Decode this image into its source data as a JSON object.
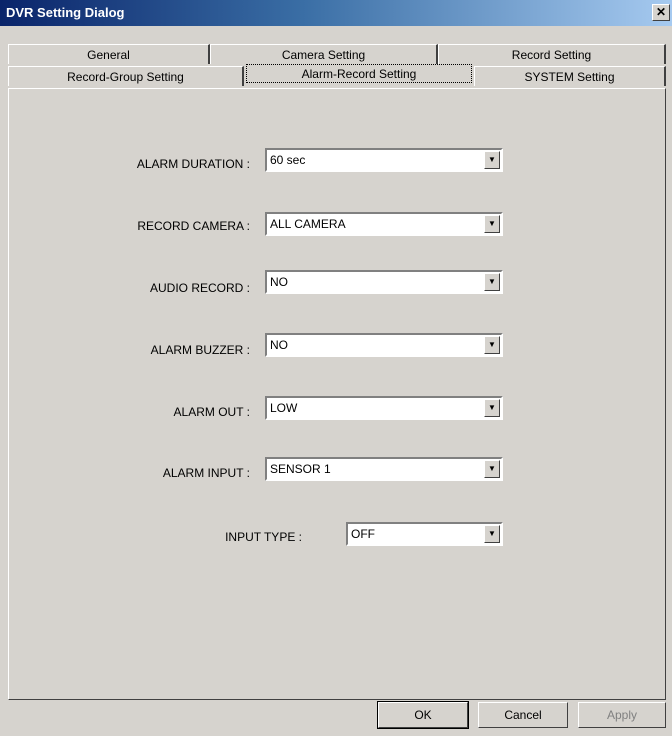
{
  "window": {
    "title": "DVR Setting Dialog",
    "close_glyph": "✕"
  },
  "tabs": {
    "row1": [
      {
        "label": "General"
      },
      {
        "label": "Camera Setting"
      },
      {
        "label": "Record Setting"
      }
    ],
    "row2": [
      {
        "label": "Record-Group Setting"
      },
      {
        "label": "Alarm-Record Setting",
        "active": true
      },
      {
        "label": "SYSTEM Setting"
      }
    ]
  },
  "fields": [
    {
      "label": "ALARM DURATION :",
      "value": "60 sec"
    },
    {
      "label": "RECORD CAMERA :",
      "value": "ALL CAMERA"
    },
    {
      "label": "AUDIO RECORD :",
      "value": "NO"
    },
    {
      "label": "ALARM BUZZER :",
      "value": "NO"
    },
    {
      "label": "ALARM OUT :",
      "value": "LOW"
    },
    {
      "label": "ALARM INPUT :",
      "value": "SENSOR 1"
    },
    {
      "label": "INPUT TYPE :",
      "value": "OFF"
    }
  ],
  "buttons": {
    "ok": "OK",
    "cancel": "Cancel",
    "apply": "Apply"
  },
  "icons": {
    "dropdown_arrow": "chevron-down-icon",
    "arrow_glyph": "▼"
  }
}
